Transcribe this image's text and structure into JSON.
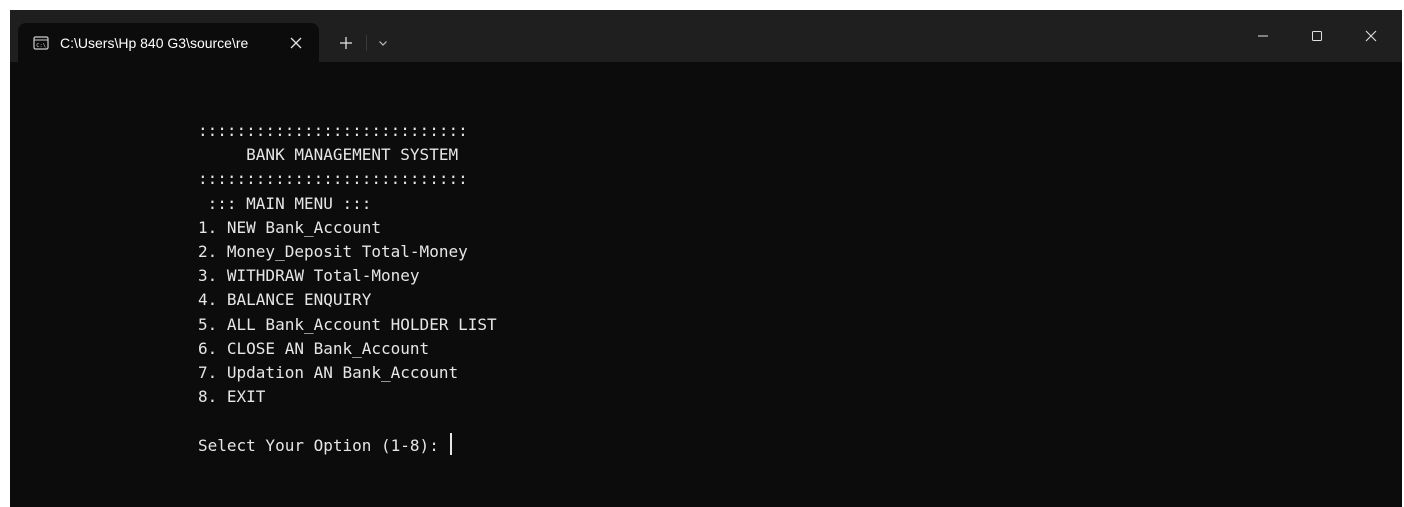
{
  "window": {
    "tab_title": "C:\\Users\\Hp 840 G3\\source\\re",
    "tab_icon": "console-icon",
    "new_tab_symbol": "+",
    "buttons": [
      "minimize-icon",
      "maximize-icon",
      "close-icon"
    ]
  },
  "console": {
    "lines": [
      "::::::::::::::::::::::::::::",
      "     BANK MANAGEMENT SYSTEM",
      "::::::::::::::::::::::::::::",
      " ::: MAIN MENU :::",
      "1. NEW Bank_Account",
      "2. Money_Deposit Total-Money",
      "3. WITHDRAW Total-Money",
      "4. BALANCE ENQUIRY",
      "5. ALL Bank_Account HOLDER LIST",
      "6. CLOSE AN Bank_Account",
      "7. Updation AN Bank_Account",
      "8. EXIT"
    ],
    "prompt": "Select Your Option (1-8): "
  },
  "colors": {
    "terminal_bg": "#0c0c0c",
    "titlebar_bg": "#1f1f1f",
    "text": "#e6e6e6"
  }
}
